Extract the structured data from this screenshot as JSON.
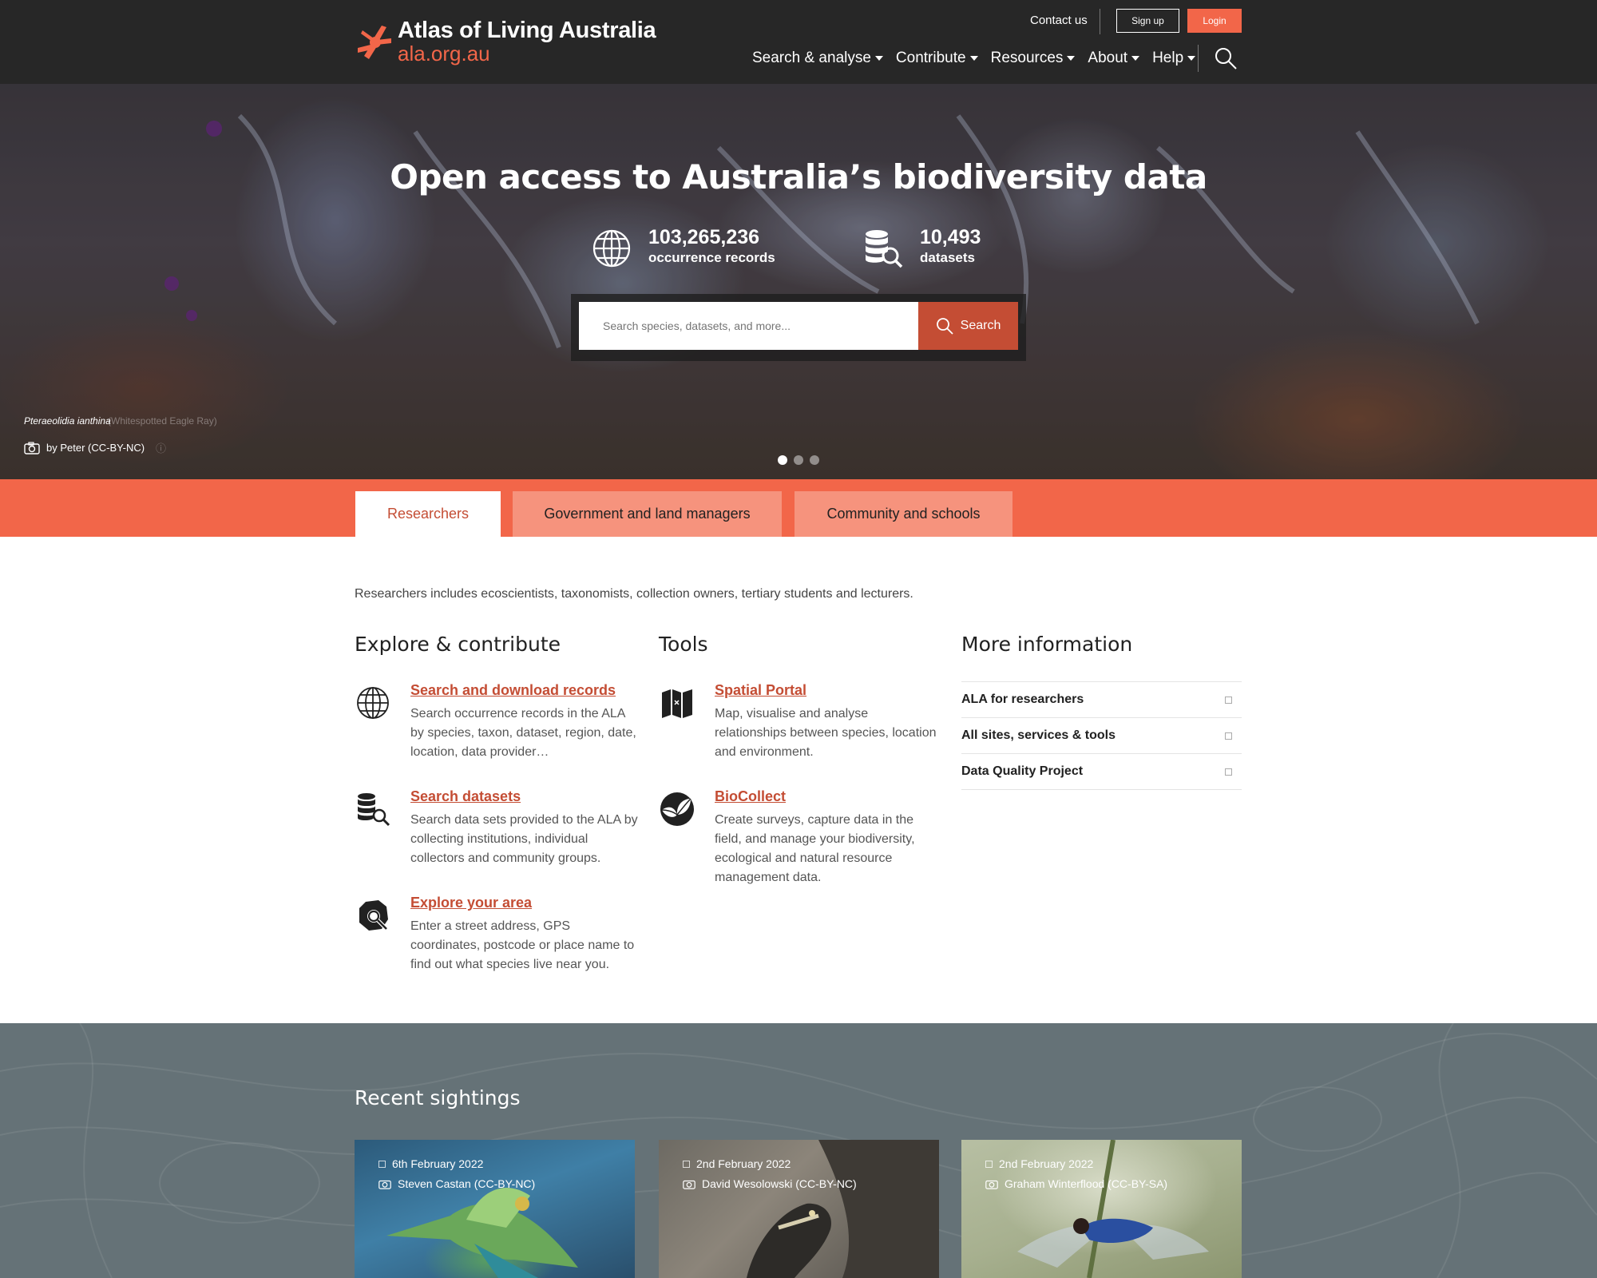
{
  "header": {
    "logo_title": "Atlas of Living Australia",
    "logo_subtitle": "ala.org.au",
    "contact": "Contact us",
    "signup": "Sign up",
    "login": "Login",
    "nav": [
      "Search & analyse",
      "Contribute",
      "Resources",
      "About",
      "Help"
    ],
    "search_icon": "search-icon"
  },
  "hero": {
    "title": "Open access to Australia’s biodiversity data",
    "stats": [
      {
        "value": "103,265,236",
        "label": "occurrence records",
        "icon": "globe-icon"
      },
      {
        "value": "10,493",
        "label": "datasets",
        "icon": "database-search-icon"
      }
    ],
    "search": {
      "placeholder": "Search species, datasets, and more...",
      "button": "Search"
    },
    "caption": {
      "species": "Pteraeolidia ianthina",
      "common": "(Whitespotted Eagle Ray)",
      "credit": "by Peter (CC-BY-NC)",
      "info": "ⓘ"
    },
    "slides": 3,
    "active_slide": 1
  },
  "tabs": [
    "Researchers",
    "Government and land managers",
    "Community and schools"
  ],
  "active_tab": "Researchers",
  "intro": "Researchers includes ecoscientists, taxonomists, collection owners, tertiary students and lecturers.",
  "explore": {
    "title": "Explore & contribute",
    "items": [
      {
        "title": "Search and download records",
        "desc": "Search occurrence records in the ALA by species, taxon, dataset, region, date, location, data provider…",
        "icon": "globe-icon"
      },
      {
        "title": "Search datasets",
        "desc": "Search data sets provided to the ALA by collecting institutions, individual collectors and community groups.",
        "icon": "database-search-icon"
      },
      {
        "title": "Explore your area",
        "desc": "Enter a street address, GPS coordinates, postcode or place name to find out what species live near you.",
        "icon": "location-search-icon"
      }
    ]
  },
  "tools": {
    "title": "Tools",
    "items": [
      {
        "title": "Spatial Portal",
        "desc": "Map, visualise and analyse relationships between species, location and environment.",
        "icon": "map-icon"
      },
      {
        "title": "BioCollect",
        "desc": "Create surveys, capture data in the field, and manage your biodiversity, ecological and natural resource management data.",
        "icon": "leaf-icon"
      }
    ]
  },
  "more_info": {
    "title": "More information",
    "items": [
      "ALA for researchers",
      "All sites, services & tools",
      "Data Quality Project"
    ]
  },
  "sightings": {
    "title": "Recent sightings",
    "cards": [
      {
        "date": "6th February 2022",
        "credit": "Steven Castan (CC-BY-NC)"
      },
      {
        "date": "2nd February 2022",
        "credit": "David Wesolowski (CC-BY-NC)"
      },
      {
        "date": "2nd February 2022",
        "credit": "Graham Winterflood (CC-BY-SA)"
      }
    ]
  },
  "colors": {
    "brand": "#f26649",
    "brand_dark": "#c44d34",
    "header_bg": "#272727",
    "sightings_bg": "#657277"
  }
}
